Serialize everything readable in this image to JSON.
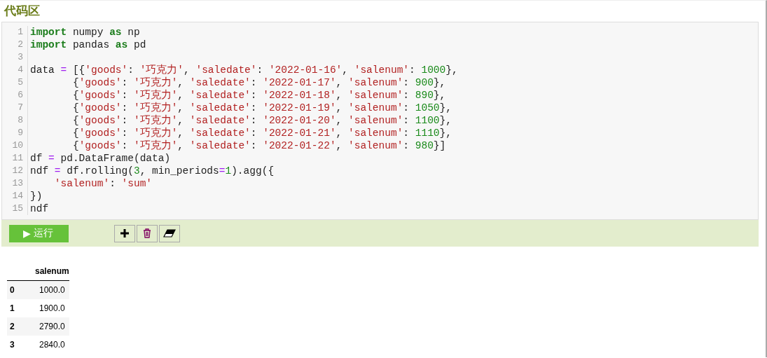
{
  "title": "代码区",
  "editor": {
    "lines": [
      {
        "number": "1",
        "tokens": [
          {
            "kind": "keyword",
            "text": "import"
          },
          {
            "kind": "plain",
            "text": " numpy "
          },
          {
            "kind": "keyword",
            "text": "as"
          },
          {
            "kind": "plain",
            "text": " np"
          }
        ]
      },
      {
        "number": "2",
        "tokens": [
          {
            "kind": "keyword",
            "text": "import"
          },
          {
            "kind": "plain",
            "text": " pandas "
          },
          {
            "kind": "keyword",
            "text": "as"
          },
          {
            "kind": "plain",
            "text": " pd"
          }
        ]
      },
      {
        "number": "3"
      },
      {
        "number": "4",
        "tokens": [
          {
            "kind": "plain",
            "text": "data "
          },
          {
            "kind": "operator",
            "text": "="
          },
          {
            "kind": "plain",
            "text": " [{"
          },
          {
            "kind": "string",
            "text": "'goods'"
          },
          {
            "kind": "plain",
            "text": ": "
          },
          {
            "kind": "string",
            "text": "'巧克力'"
          },
          {
            "kind": "plain",
            "text": ", "
          },
          {
            "kind": "string",
            "text": "'saledate'"
          },
          {
            "kind": "plain",
            "text": ": "
          },
          {
            "kind": "string",
            "text": "'2022-01-16'"
          },
          {
            "kind": "plain",
            "text": ", "
          },
          {
            "kind": "string",
            "text": "'salenum'"
          },
          {
            "kind": "plain",
            "text": ": "
          },
          {
            "kind": "number",
            "text": "1000"
          },
          {
            "kind": "plain",
            "text": "},"
          }
        ]
      },
      {
        "number": "5",
        "tokens": [
          {
            "kind": "plain",
            "text": "       {"
          },
          {
            "kind": "string",
            "text": "'goods'"
          },
          {
            "kind": "plain",
            "text": ": "
          },
          {
            "kind": "string",
            "text": "'巧克力'"
          },
          {
            "kind": "plain",
            "text": ", "
          },
          {
            "kind": "string",
            "text": "'saledate'"
          },
          {
            "kind": "plain",
            "text": ": "
          },
          {
            "kind": "string",
            "text": "'2022-01-17'"
          },
          {
            "kind": "plain",
            "text": ", "
          },
          {
            "kind": "string",
            "text": "'salenum'"
          },
          {
            "kind": "plain",
            "text": ": "
          },
          {
            "kind": "number",
            "text": "900"
          },
          {
            "kind": "plain",
            "text": "},"
          }
        ]
      },
      {
        "number": "6",
        "tokens": [
          {
            "kind": "plain",
            "text": "       {"
          },
          {
            "kind": "string",
            "text": "'goods'"
          },
          {
            "kind": "plain",
            "text": ": "
          },
          {
            "kind": "string",
            "text": "'巧克力'"
          },
          {
            "kind": "plain",
            "text": ", "
          },
          {
            "kind": "string",
            "text": "'saledate'"
          },
          {
            "kind": "plain",
            "text": ": "
          },
          {
            "kind": "string",
            "text": "'2022-01-18'"
          },
          {
            "kind": "plain",
            "text": ", "
          },
          {
            "kind": "string",
            "text": "'salenum'"
          },
          {
            "kind": "plain",
            "text": ": "
          },
          {
            "kind": "number",
            "text": "890"
          },
          {
            "kind": "plain",
            "text": "},"
          }
        ]
      },
      {
        "number": "7",
        "tokens": [
          {
            "kind": "plain",
            "text": "       {"
          },
          {
            "kind": "string",
            "text": "'goods'"
          },
          {
            "kind": "plain",
            "text": ": "
          },
          {
            "kind": "string",
            "text": "'巧克力'"
          },
          {
            "kind": "plain",
            "text": ", "
          },
          {
            "kind": "string",
            "text": "'saledate'"
          },
          {
            "kind": "plain",
            "text": ": "
          },
          {
            "kind": "string",
            "text": "'2022-01-19'"
          },
          {
            "kind": "plain",
            "text": ", "
          },
          {
            "kind": "string",
            "text": "'salenum'"
          },
          {
            "kind": "plain",
            "text": ": "
          },
          {
            "kind": "number",
            "text": "1050"
          },
          {
            "kind": "plain",
            "text": "},"
          }
        ]
      },
      {
        "number": "8",
        "tokens": [
          {
            "kind": "plain",
            "text": "       {"
          },
          {
            "kind": "string",
            "text": "'goods'"
          },
          {
            "kind": "plain",
            "text": ": "
          },
          {
            "kind": "string",
            "text": "'巧克力'"
          },
          {
            "kind": "plain",
            "text": ", "
          },
          {
            "kind": "string",
            "text": "'saledate'"
          },
          {
            "kind": "plain",
            "text": ": "
          },
          {
            "kind": "string",
            "text": "'2022-01-20'"
          },
          {
            "kind": "plain",
            "text": ", "
          },
          {
            "kind": "string",
            "text": "'salenum'"
          },
          {
            "kind": "plain",
            "text": ": "
          },
          {
            "kind": "number",
            "text": "1100"
          },
          {
            "kind": "plain",
            "text": "},"
          }
        ]
      },
      {
        "number": "9",
        "tokens": [
          {
            "kind": "plain",
            "text": "       {"
          },
          {
            "kind": "string",
            "text": "'goods'"
          },
          {
            "kind": "plain",
            "text": ": "
          },
          {
            "kind": "string",
            "text": "'巧克力'"
          },
          {
            "kind": "plain",
            "text": ", "
          },
          {
            "kind": "string",
            "text": "'saledate'"
          },
          {
            "kind": "plain",
            "text": ": "
          },
          {
            "kind": "string",
            "text": "'2022-01-21'"
          },
          {
            "kind": "plain",
            "text": ", "
          },
          {
            "kind": "string",
            "text": "'salenum'"
          },
          {
            "kind": "plain",
            "text": ": "
          },
          {
            "kind": "number",
            "text": "1110"
          },
          {
            "kind": "plain",
            "text": "},"
          }
        ]
      },
      {
        "number": "10",
        "tokens": [
          {
            "kind": "plain",
            "text": "       {"
          },
          {
            "kind": "string",
            "text": "'goods'"
          },
          {
            "kind": "plain",
            "text": ": "
          },
          {
            "kind": "string",
            "text": "'巧克力'"
          },
          {
            "kind": "plain",
            "text": ", "
          },
          {
            "kind": "string",
            "text": "'saledate'"
          },
          {
            "kind": "plain",
            "text": ": "
          },
          {
            "kind": "string",
            "text": "'2022-01-22'"
          },
          {
            "kind": "plain",
            "text": ", "
          },
          {
            "kind": "string",
            "text": "'salenum'"
          },
          {
            "kind": "plain",
            "text": ": "
          },
          {
            "kind": "number",
            "text": "980"
          },
          {
            "kind": "plain",
            "text": "}]"
          }
        ]
      },
      {
        "number": "11",
        "tokens": [
          {
            "kind": "plain",
            "text": "df "
          },
          {
            "kind": "operator",
            "text": "="
          },
          {
            "kind": "plain",
            "text": " pd.DataFrame(data)"
          }
        ]
      },
      {
        "number": "12",
        "tokens": [
          {
            "kind": "plain",
            "text": "ndf "
          },
          {
            "kind": "operator",
            "text": "="
          },
          {
            "kind": "plain",
            "text": " df.rolling("
          },
          {
            "kind": "number",
            "text": "3"
          },
          {
            "kind": "plain",
            "text": ", min_periods"
          },
          {
            "kind": "operator",
            "text": "="
          },
          {
            "kind": "number",
            "text": "1"
          },
          {
            "kind": "plain",
            "text": ").agg({"
          }
        ]
      },
      {
        "number": "13",
        "tokens": [
          {
            "kind": "string",
            "text": "    'salenum'"
          },
          {
            "kind": "plain",
            "text": ": "
          },
          {
            "kind": "string",
            "text": "'sum'"
          }
        ]
      },
      {
        "number": "14",
        "tokens": [
          {
            "kind": "plain",
            "text": "})"
          }
        ]
      },
      {
        "number": "15",
        "tokens": [
          {
            "kind": "plain",
            "text": "ndf"
          }
        ]
      }
    ]
  },
  "toolbar": {
    "run_button": {
      "icon": "▶",
      "label": "运行"
    },
    "tools": [
      {
        "kind": "add"
      },
      {
        "kind": "delete"
      },
      {
        "kind": "clear"
      }
    ]
  },
  "output": {
    "columns": [
      "salenum"
    ],
    "rows": [
      {
        "index": "0",
        "values": [
          "1000.0"
        ]
      },
      {
        "index": "1",
        "values": [
          "1900.0"
        ]
      },
      {
        "index": "2",
        "values": [
          "2790.0"
        ]
      },
      {
        "index": "3",
        "values": [
          "2840.0"
        ]
      }
    ]
  }
}
